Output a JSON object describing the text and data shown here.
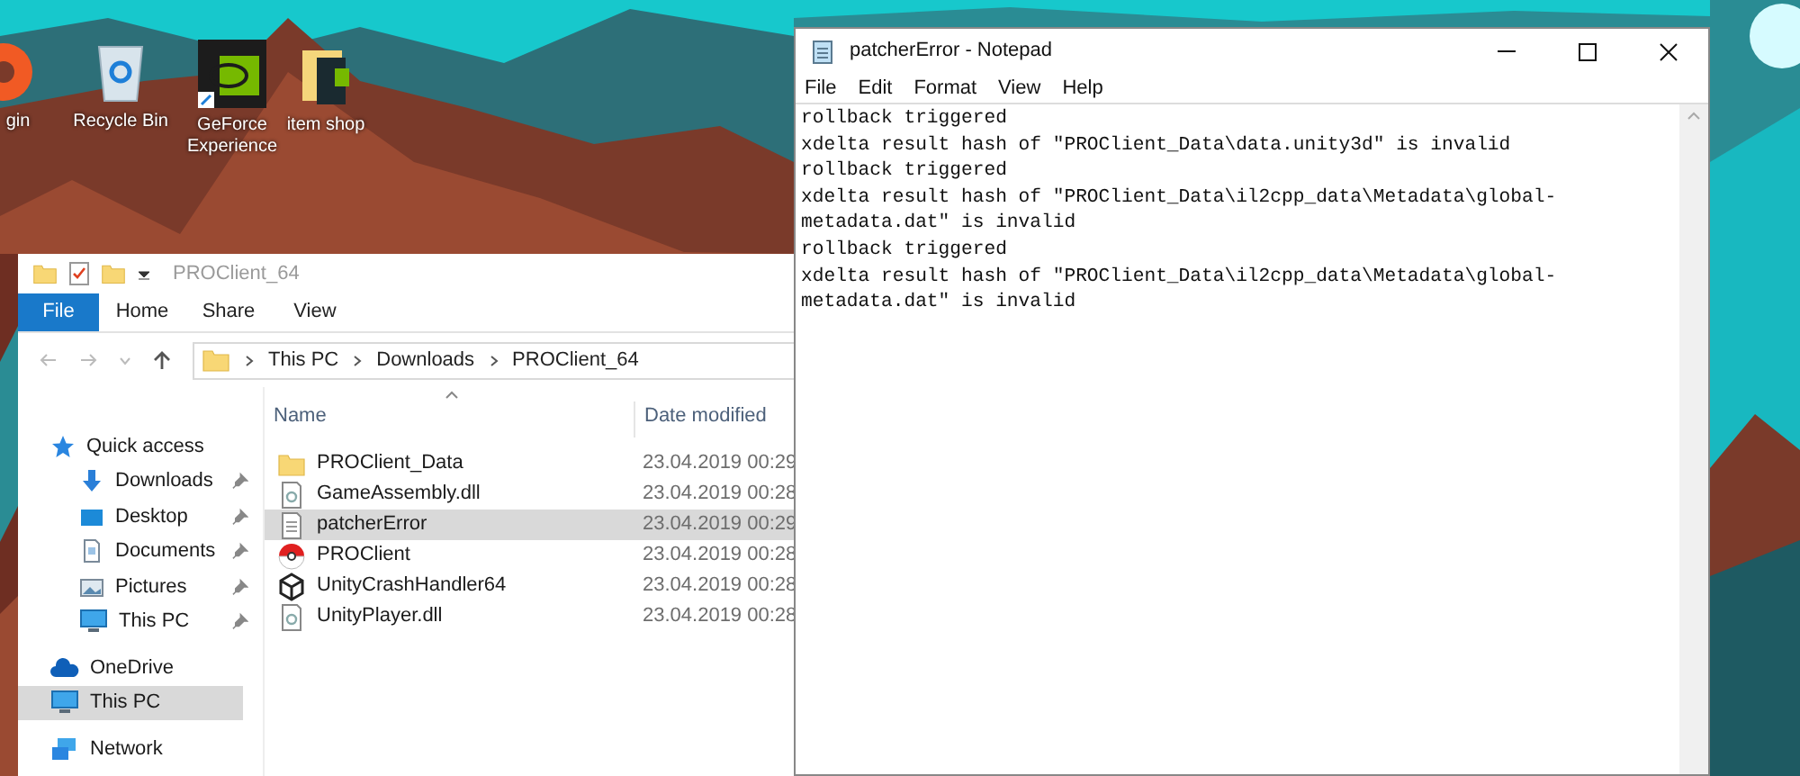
{
  "desktop_icons": [
    {
      "label": "gin",
      "kind": "orange-app"
    },
    {
      "label": "Recycle Bin",
      "kind": "bin"
    },
    {
      "label": "GeForce Experience",
      "kind": "nvidia"
    },
    {
      "label": "item shop",
      "kind": "folder"
    }
  ],
  "explorer": {
    "title": "PROClient_64",
    "ribbon_tabs": [
      {
        "label": "File",
        "selected": true
      },
      {
        "label": "Home",
        "selected": false
      },
      {
        "label": "Share",
        "selected": false
      },
      {
        "label": "View",
        "selected": false
      }
    ],
    "breadcrumbs": [
      "This PC",
      "Downloads",
      "PROClient_64"
    ],
    "nav": [
      {
        "label": "Quick access",
        "kind": "star",
        "selected": false,
        "children": [
          {
            "label": "Downloads",
            "kind": "download",
            "pinned": true,
            "selected": false
          },
          {
            "label": "Desktop",
            "kind": "desktop",
            "pinned": true,
            "selected": false
          },
          {
            "label": "Documents",
            "kind": "document",
            "pinned": true,
            "selected": false
          },
          {
            "label": "Pictures",
            "kind": "picture",
            "pinned": true,
            "selected": false
          },
          {
            "label": "This PC",
            "kind": "pc",
            "pinned": true,
            "selected": false
          }
        ]
      },
      {
        "label": "OneDrive",
        "kind": "cloud",
        "selected": false
      },
      {
        "label": "This PC",
        "kind": "pc",
        "selected": true
      },
      {
        "label": "Network",
        "kind": "network",
        "selected": false
      }
    ],
    "columns": [
      "Name",
      "Date modified"
    ],
    "files": [
      {
        "name": "PROClient_Data",
        "date": "23.04.2019 00:29",
        "kind": "folder",
        "selected": false
      },
      {
        "name": "GameAssembly.dll",
        "date": "23.04.2019 00:28",
        "kind": "dll",
        "selected": false
      },
      {
        "name": "patcherError",
        "date": "23.04.2019 00:29",
        "kind": "text",
        "selected": true
      },
      {
        "name": "PROClient",
        "date": "23.04.2019 00:28",
        "kind": "ball",
        "selected": false
      },
      {
        "name": "UnityCrashHandler64",
        "date": "23.04.2019 00:28",
        "kind": "unity",
        "selected": false
      },
      {
        "name": "UnityPlayer.dll",
        "date": "23.04.2019 00:28",
        "kind": "dll",
        "selected": false
      }
    ]
  },
  "notepad": {
    "title": "patcherError - Notepad",
    "menu": [
      "File",
      "Edit",
      "Format",
      "View",
      "Help"
    ],
    "lines": [
      "rollback triggered",
      "xdelta result hash of \"PROClient_Data\\data.unity3d\" is invalid",
      "rollback triggered",
      "xdelta result hash of \"PROClient_Data\\il2cpp_data\\Metadata\\global-",
      "metadata.dat\" is invalid",
      "rollback triggered",
      "xdelta result hash of \"PROClient_Data\\il2cpp_data\\Metadata\\global-",
      "metadata.dat\" is invalid"
    ]
  }
}
